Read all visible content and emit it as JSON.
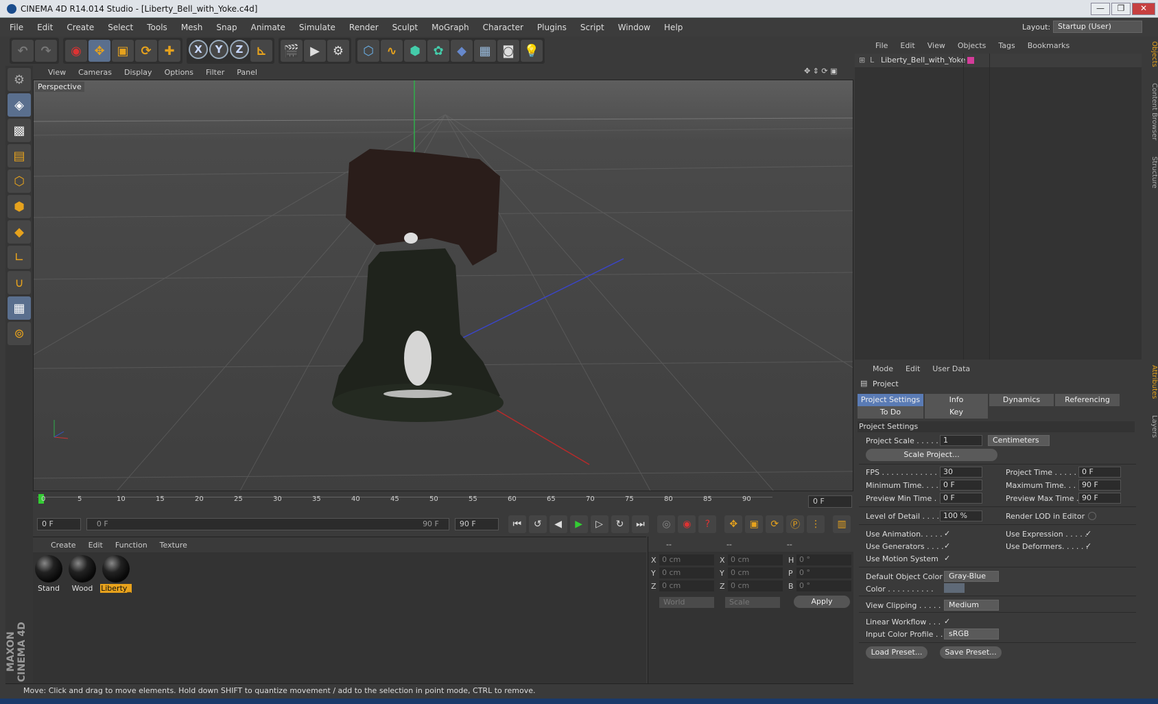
{
  "window": {
    "title": "CINEMA 4D R14.014 Studio - [Liberty_Bell_with_Yoke.c4d]",
    "min": "—",
    "max": "❐",
    "close": "✕"
  },
  "menubar": {
    "items": [
      "File",
      "Edit",
      "Create",
      "Select",
      "Tools",
      "Mesh",
      "Snap",
      "Animate",
      "Simulate",
      "Render",
      "Sculpt",
      "MoGraph",
      "Character",
      "Plugins",
      "Script",
      "Window",
      "Help"
    ],
    "layout_label": "Layout:",
    "layout_value": "Startup (User)"
  },
  "viewport": {
    "menu": [
      "View",
      "Cameras",
      "Display",
      "Options",
      "Filter",
      "Panel"
    ],
    "label": "Perspective"
  },
  "timeline": {
    "ticks": [
      "0",
      "5",
      "10",
      "15",
      "20",
      "25",
      "30",
      "35",
      "40",
      "45",
      "50",
      "55",
      "60",
      "65",
      "70",
      "75",
      "80",
      "85",
      "90"
    ],
    "frame_field": "0 F"
  },
  "transport": {
    "start": "0 F",
    "slider_left": "0 F",
    "slider_right": "90 F",
    "end": "90 F"
  },
  "materials": {
    "menu": [
      "Create",
      "Edit",
      "Function",
      "Texture"
    ],
    "items": [
      "Stand",
      "Wood",
      "Liberty_"
    ]
  },
  "coords": {
    "head": [
      "--",
      "--",
      "--"
    ],
    "rows": [
      [
        "X",
        "0 cm",
        "X",
        "0 cm",
        "H",
        "0 °"
      ],
      [
        "Y",
        "0 cm",
        "Y",
        "0 cm",
        "P",
        "0 °"
      ],
      [
        "Z",
        "0 cm",
        "Z",
        "0 cm",
        "B",
        "0 °"
      ]
    ],
    "world": "World",
    "scale": "Scale",
    "apply": "Apply"
  },
  "status": "Move: Click and drag to move elements. Hold down SHIFT to quantize movement / add to the selection in point mode, CTRL to remove.",
  "objects": {
    "menu": [
      "File",
      "Edit",
      "View",
      "Objects",
      "Tags",
      "Bookmarks"
    ],
    "item": "Liberty_Bell_with_Yoke"
  },
  "attributes": {
    "menu": [
      "Mode",
      "Edit",
      "User Data"
    ],
    "header": "Project",
    "tabs": [
      "Project Settings",
      "Info",
      "Dynamics",
      "Referencing"
    ],
    "tabs2": [
      "To Do",
      "Key Interpolation"
    ],
    "section": "Project Settings",
    "project_scale_label": "Project Scale . . . . . .",
    "project_scale": "1",
    "units": "Centimeters",
    "scale_btn": "Scale Project...",
    "fps_label": "FPS . . . . . . . . . . . . . . .",
    "fps": "30",
    "project_time_label": "Project Time . . . . . . . .",
    "project_time": "0 F",
    "min_time_label": "Minimum Time. . . . .",
    "min_time": "0 F",
    "max_time_label": "Maximum Time. . . . . .",
    "max_time": "90 F",
    "prev_min_label": "Preview Min Time . .",
    "prev_min": "0 F",
    "prev_max_label": "Preview Max Time . . .",
    "prev_max": "90 F",
    "lod_label": "Level of Detail . . . . . .",
    "lod": "100 %",
    "render_lod_label": "Render LOD in Editor",
    "use_anim": "Use Animation. . . . .",
    "use_expr": "Use Expression . . . . .",
    "use_gen": "Use Generators . . . .",
    "use_def": "Use Deformers. . . . . .",
    "use_motion": "Use Motion System",
    "def_color_label": "Default Object Color",
    "def_color": "Gray-Blue",
    "color_label": "Color . . . . . . . . . .",
    "clip_label": "View Clipping . . . . . .",
    "clip": "Medium",
    "linear_label": "Linear Workflow . . .",
    "icp_label": "Input Color Profile . .",
    "icp": "sRGB",
    "load_preset": "Load Preset...",
    "save_preset": "Save Preset..."
  },
  "side_tabs": [
    "Objects",
    "Content Browser",
    "Structure",
    "Attributes",
    "Layers"
  ],
  "logo": "MAXON CINEMA 4D"
}
